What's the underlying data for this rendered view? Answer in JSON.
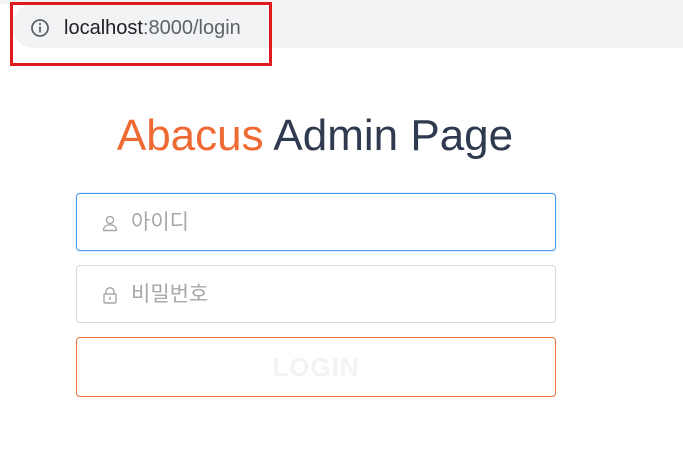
{
  "browser": {
    "url_host": "localhost",
    "url_path": ":8000/login",
    "info_icon": "info-circle-icon",
    "highlight_color": "#e0191f"
  },
  "login": {
    "title_brand": "Abacus",
    "title_rest": "Admin Page",
    "brand_color": "#ef6a33",
    "title_color": "#2f3a4f",
    "id_placeholder": "아이디",
    "id_value": "",
    "id_icon": "user-icon",
    "password_placeholder": "비밀번호",
    "password_value": "",
    "password_icon": "lock-icon",
    "login_button_label": "LOGIN",
    "accent_color": "#e8703e",
    "focus_color": "#4a9ef0"
  }
}
